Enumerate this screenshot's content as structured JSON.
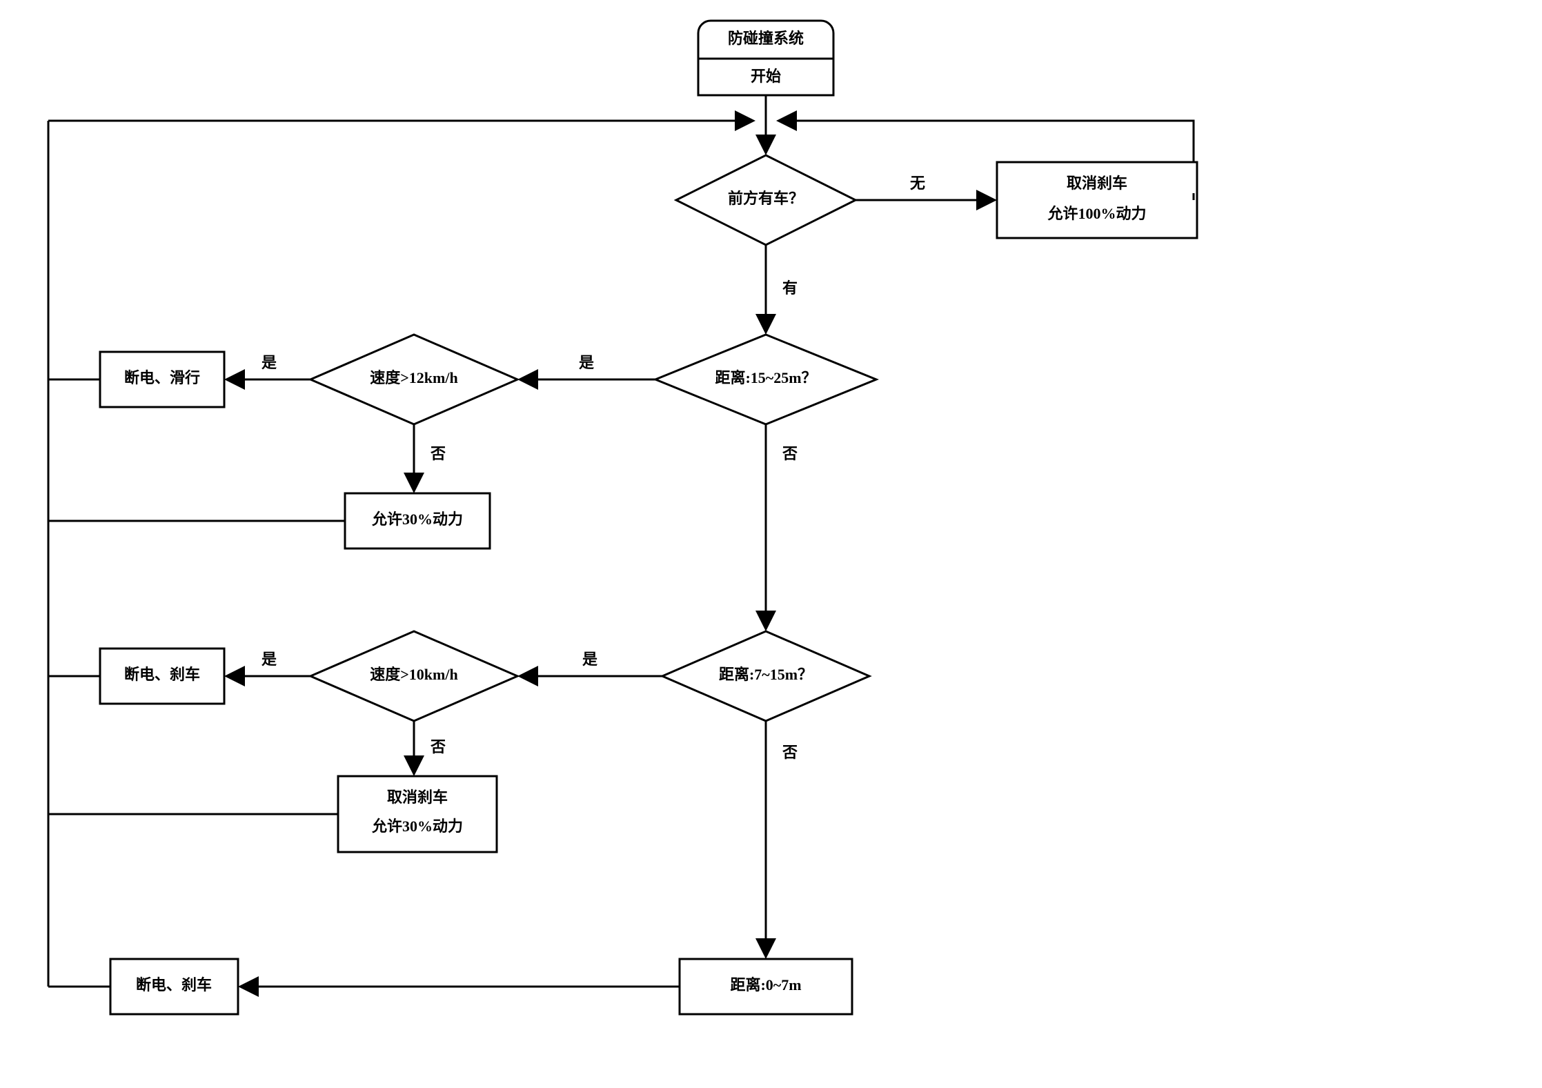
{
  "start": {
    "title": "防碰撞系统",
    "subtitle": "开始"
  },
  "decisions": {
    "d1": "前方有车？",
    "d2": "距离:15~25m？",
    "d3": "速度>12km/h",
    "d4": "距离:7~15m？",
    "d5": "速度>10km/h"
  },
  "processes": {
    "p_clear": {
      "l1": "取消刹车",
      "l2": "允许100%动力"
    },
    "p_coast": "断电、滑行",
    "p_allow30": "允许30%动力",
    "p_brake1": "断电、刹车",
    "p_cancel30": {
      "l1": "取消刹车",
      "l2": "允许30%动力"
    },
    "p_dist07": "距离:0~7m",
    "p_brake2": "断电、刹车"
  },
  "edges": {
    "no_car": "无",
    "has_car": "有",
    "yes": "是",
    "no": "否"
  }
}
